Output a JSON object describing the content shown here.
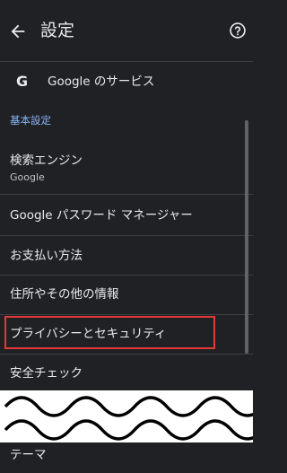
{
  "header": {
    "title": "設定",
    "back_icon": "arrow-back-icon",
    "help_icon": "help-circle-icon"
  },
  "google_services": {
    "icon": "G",
    "label": "Google のサービス"
  },
  "section_basic": "基本設定",
  "items": [
    {
      "label": "検索エンジン",
      "sub": "Google"
    },
    {
      "label": "Google パスワード マネージャー"
    },
    {
      "label": "お支払い方法"
    },
    {
      "label": "住所やその他の情報"
    },
    {
      "label": "プライバシーとセキュリティ"
    },
    {
      "label": "安全チェック"
    },
    {
      "label": "テーマ"
    }
  ],
  "colors": {
    "background": "#202124",
    "text": "#e8eaed",
    "accent": "#8ab4f8",
    "highlight": "#e53935"
  }
}
